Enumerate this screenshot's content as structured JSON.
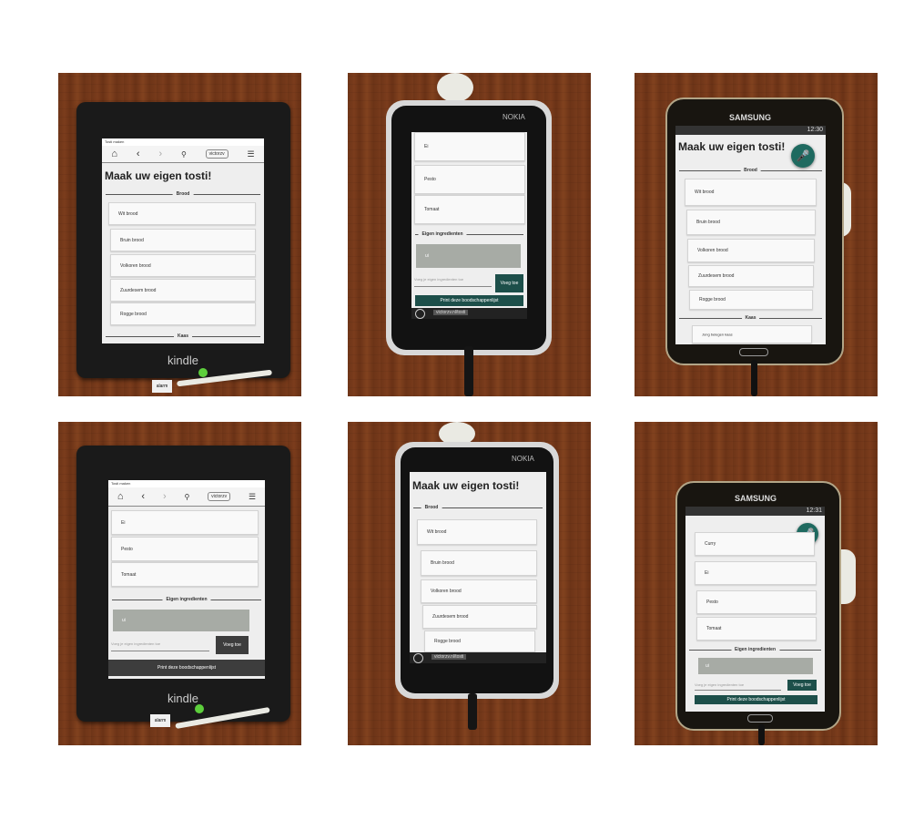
{
  "app": {
    "title": "Maak uw eigen tosti!",
    "sections": {
      "brood": "Brood",
      "kaas": "Kaas",
      "eigen": "Eigen ingredienten"
    },
    "brood_items": [
      "Wit brood",
      "Bruin brood",
      "Volkoren brood",
      "Zuurdesem brood",
      "Rogge brood"
    ],
    "kaas_items": [
      "Jong belegen kaas"
    ],
    "extra_items": [
      "Curry",
      "Ei",
      "Pesto",
      "Tomaat"
    ],
    "custom_item": "ui",
    "input_placeholder": "Voeg je eigen ingredienten toe",
    "add_button": "Voeg toe",
    "print_button": "Print deze boodschappenlijst",
    "url": "victorzv"
  },
  "devices": {
    "kindle": {
      "brand": "kindle",
      "status_left": "Tosti maken",
      "tag": "alarm"
    },
    "nokia": {
      "brand": "NOKIA",
      "url": "victorzv.nl/tosti"
    },
    "samsung": {
      "brand": "SAMSUNG",
      "time_top": "12:30",
      "time_bottom": "12:31"
    }
  },
  "colors": {
    "accent": "#1d4f4a",
    "mic": "#1f6a60",
    "wood": "#743a1b"
  },
  "icons": [
    "home-icon",
    "back-icon",
    "forward-icon",
    "location-icon",
    "refresh-icon",
    "menu-icon",
    "mic-icon"
  ]
}
